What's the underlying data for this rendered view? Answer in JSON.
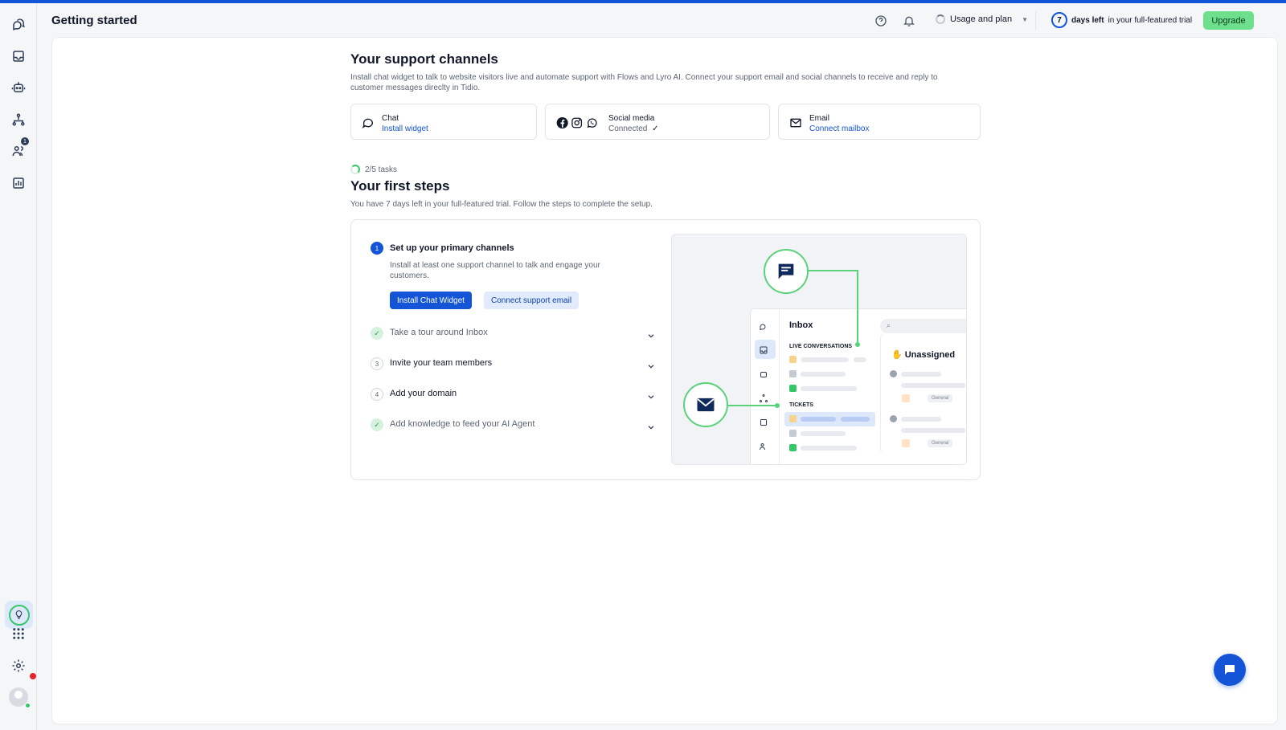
{
  "header": {
    "title": "Getting started",
    "usage_label": "Usage and plan",
    "trial_days": "7",
    "trial_days_label": "days left",
    "trial_suffix": "in your full-featured trial",
    "upgrade_label": "Upgrade"
  },
  "sidebar": {
    "items": [
      {
        "name": "conversations",
        "icon": "chat-bubbles-icon"
      },
      {
        "name": "inbox",
        "icon": "inbox-icon"
      },
      {
        "name": "ai-agent",
        "icon": "bot-icon"
      },
      {
        "name": "flows",
        "icon": "flows-icon"
      },
      {
        "name": "contacts",
        "icon": "contacts-icon",
        "badge": "1"
      },
      {
        "name": "analytics",
        "icon": "analytics-icon"
      }
    ],
    "bottom": [
      {
        "name": "getting-started",
        "icon": "lightbulb-icon"
      },
      {
        "name": "apps",
        "icon": "grid-icon"
      },
      {
        "name": "settings",
        "icon": "gear-icon"
      }
    ]
  },
  "support_channels": {
    "title": "Your support channels",
    "description": "Install chat widget to talk to website visitors live and automate support with Flows and Lyro AI. Connect your support email and social channels to receive and reply to customer messages direclty in Tidio.",
    "cards": [
      {
        "label": "Chat",
        "action": "Install widget"
      },
      {
        "label": "Social media",
        "status": "Connected"
      },
      {
        "label": "Email",
        "action": "Connect mailbox"
      }
    ]
  },
  "first_steps": {
    "tasks_progress": "2/5 tasks",
    "title": "Your first steps",
    "description": "You have 7 days left in your full-featured trial. Follow the steps to complete the setup.",
    "steps": [
      {
        "num": "1",
        "title": "Set up your primary channels",
        "state": "active",
        "description": "Install at least one support channel to talk and engage your customers.",
        "primary_button": "Install Chat Widget",
        "secondary_button": "Connect support email"
      },
      {
        "num": "✓",
        "title": "Take a tour around Inbox",
        "state": "done"
      },
      {
        "num": "3",
        "title": "Invite your team members",
        "state": "todo"
      },
      {
        "num": "4",
        "title": "Add your domain",
        "state": "todo"
      },
      {
        "num": "✓",
        "title": "Add knowledge to feed your AI Agent",
        "state": "done"
      }
    ]
  },
  "illustration": {
    "inbox_title": "Inbox",
    "live_conversations": "LIVE CONVERSATIONS",
    "tickets": "TICKETS",
    "unassigned": "Unassigned",
    "tag1": "General",
    "tag2": "General"
  },
  "colors": {
    "accent": "#1355d6",
    "success": "#35c866",
    "upgrade": "#6ee08d"
  }
}
